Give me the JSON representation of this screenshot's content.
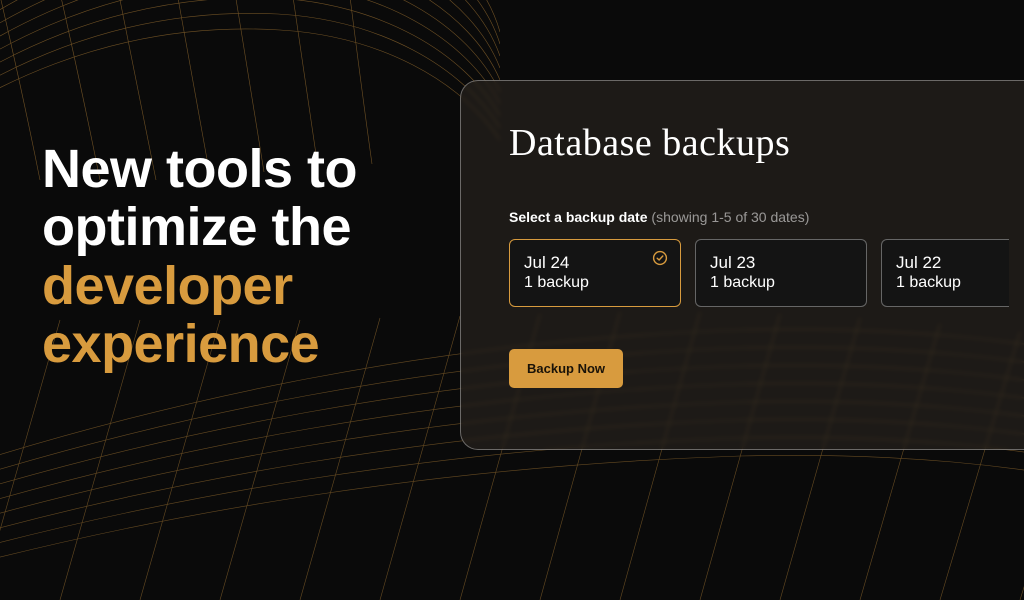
{
  "hero": {
    "line1": "New tools to",
    "line2": "optimize the",
    "line3": "developer",
    "line4": "experience"
  },
  "panel": {
    "title": "Database backups",
    "subhead_bold": "Select a backup date",
    "subhead_muted": "(showing 1-5 of 30 dates)",
    "backup_now_label": "Backup Now"
  },
  "cards": [
    {
      "date": "Jul 24",
      "count": "1 backup",
      "selected": true
    },
    {
      "date": "Jul 23",
      "count": "1 backup",
      "selected": false
    },
    {
      "date": "Jul 22",
      "count": "1 backup",
      "selected": false
    }
  ],
  "colors": {
    "accent": "#d89b3e",
    "bg": "#0a0a0a"
  }
}
